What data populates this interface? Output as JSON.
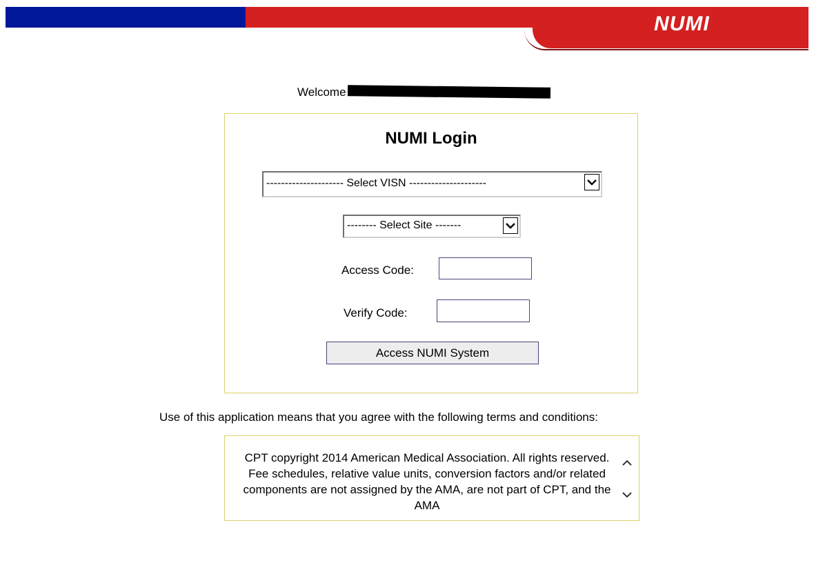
{
  "header": {
    "logo_text": "NUMI",
    "colors": {
      "blue": "#00179a",
      "red": "#d42020"
    }
  },
  "welcome": {
    "label": "Welcome"
  },
  "login": {
    "title": "NUMI Login",
    "visn_select": {
      "selected": "--------------------- Select VISN ---------------------"
    },
    "site_select": {
      "selected": "-------- Select Site -------"
    },
    "access_code_label": "Access Code:",
    "access_code_value": "",
    "verify_code_label": "Verify Code:",
    "verify_code_value": "",
    "submit_label": "Access NUMI System"
  },
  "terms": {
    "intro": "Use of this application means that you agree with the following terms and conditions:",
    "text": "CPT copyright 2014 American Medical Association. All rights reserved. Fee schedules, relative value units, conversion factors and/or related components are not assigned by the AMA, are not part of CPT, and the AMA"
  }
}
